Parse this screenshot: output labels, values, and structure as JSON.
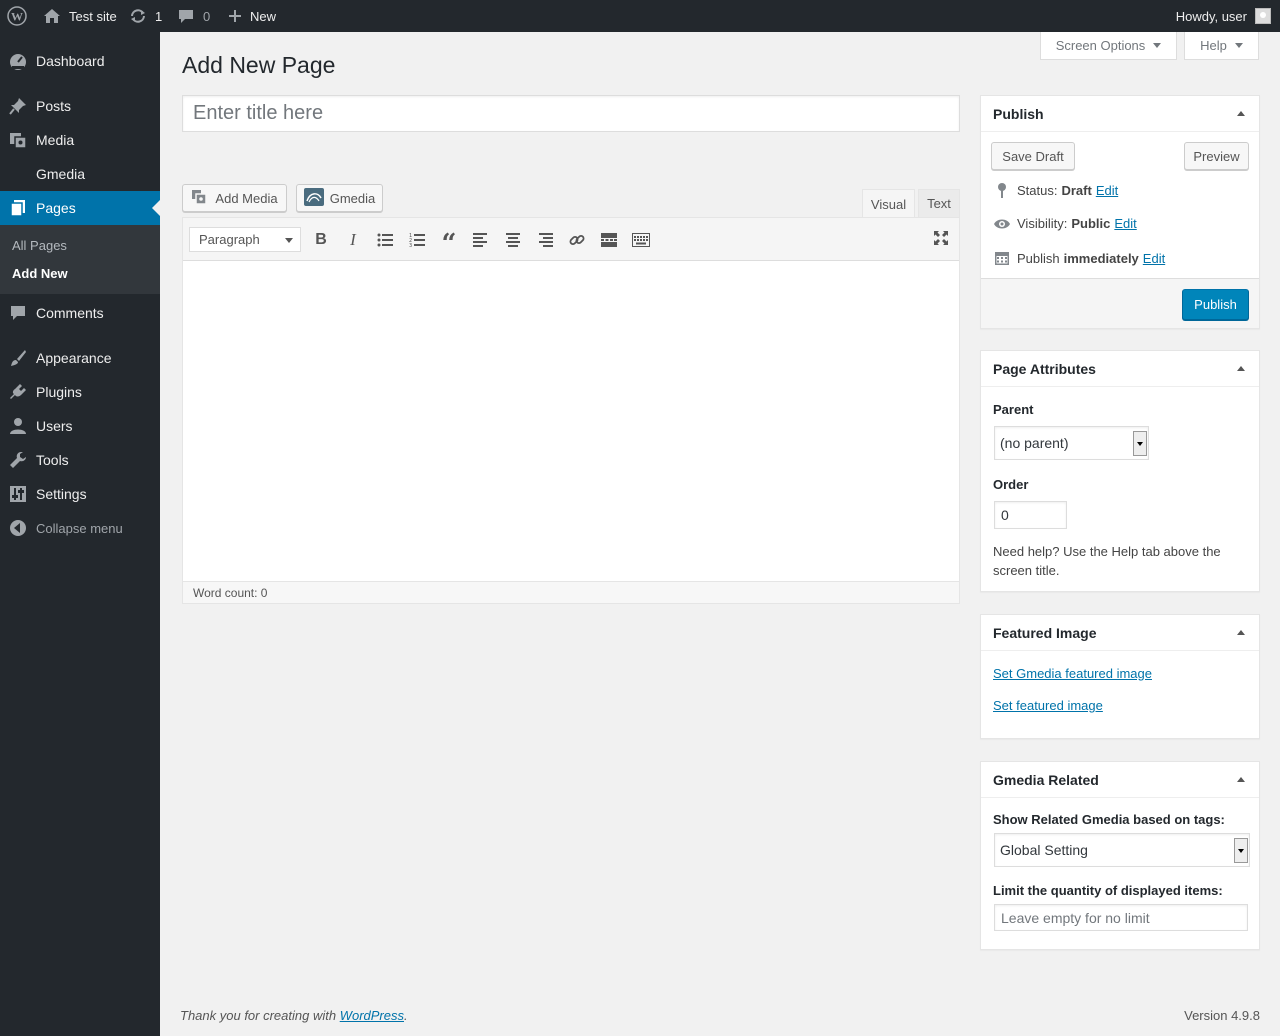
{
  "adminbar": {
    "site_name": "Test site",
    "updates_count": "1",
    "comments_count": "0",
    "new_label": "New",
    "howdy": "Howdy, user"
  },
  "sidebar": {
    "items": [
      {
        "label": "Dashboard",
        "icon": "dashboard-icon"
      },
      {
        "label": "Posts",
        "icon": "pin-icon"
      },
      {
        "label": "Media",
        "icon": "media-icon"
      },
      {
        "label": "Gmedia",
        "icon": "gmedia-icon"
      },
      {
        "label": "Pages",
        "icon": "pages-icon"
      },
      {
        "label": "Comments",
        "icon": "comment-icon"
      },
      {
        "label": "Appearance",
        "icon": "brush-icon"
      },
      {
        "label": "Plugins",
        "icon": "plugin-icon"
      },
      {
        "label": "Users",
        "icon": "user-icon"
      },
      {
        "label": "Tools",
        "icon": "wrench-icon"
      },
      {
        "label": "Settings",
        "icon": "settings-icon"
      }
    ],
    "submenu": {
      "all_pages": "All Pages",
      "add_new": "Add New"
    },
    "collapse_label": "Collapse menu"
  },
  "screen_meta": {
    "screen_options": "Screen Options",
    "help": "Help"
  },
  "page_title": "Add New Page",
  "title_field": {
    "placeholder": "Enter title here",
    "value": ""
  },
  "media_buttons": {
    "add_media": "Add Media",
    "gmedia": "Gmedia"
  },
  "editor": {
    "tab_visual": "Visual",
    "tab_text": "Text",
    "format_select": "Paragraph",
    "word_count": "Word count: 0"
  },
  "publish_box": {
    "title": "Publish",
    "save_draft": "Save Draft",
    "preview": "Preview",
    "status_label": "Status:",
    "status_value": "Draft",
    "visibility_label": "Visibility:",
    "visibility_value": "Public",
    "publish_label": "Publish",
    "publish_value": "immediately",
    "edit_link": "Edit",
    "publish_button": "Publish"
  },
  "page_attributes": {
    "title": "Page Attributes",
    "parent_label": "Parent",
    "parent_value": "(no parent)",
    "order_label": "Order",
    "order_value": "0",
    "help_text": "Need help? Use the Help tab above the screen title."
  },
  "featured_image": {
    "title": "Featured Image",
    "gmedia_link": "Set Gmedia featured image",
    "featured_link": "Set featured image"
  },
  "gmedia_related": {
    "title": "Gmedia Related",
    "tags_label": "Show Related Gmedia based on tags:",
    "tags_value": "Global Setting",
    "limit_label": "Limit the quantity of displayed items:",
    "limit_placeholder": "Leave empty for no limit"
  },
  "footer": {
    "thanks_prefix": "Thank you for creating with",
    "wordpress_link": "WordPress",
    "thanks_suffix": ".",
    "version": "Version 4.9.8"
  },
  "colors": {
    "accent": "#0073aa",
    "adminbar": "#23282d",
    "primary_button": "#0085ba"
  }
}
